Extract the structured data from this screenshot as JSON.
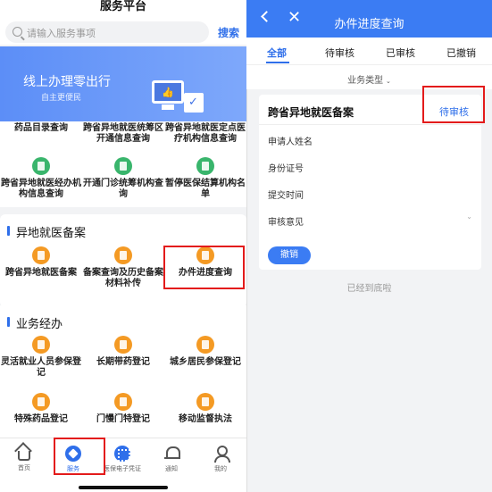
{
  "left": {
    "title": "服务平台",
    "search": {
      "placeholder": "请输入服务事项",
      "button": "搜索"
    },
    "banner": {
      "title": "线上办理零出行",
      "subtitle": "自主更便民"
    },
    "top_row_labels": [
      "药品目录查询",
      "跨省异地就医统筹区开通信息查询",
      "跨省异地就医定点医疗机构信息查询"
    ],
    "query_items": [
      {
        "label": "跨省异地就医经办机构信息查询",
        "icon": "hospital-icon"
      },
      {
        "label": "开通门诊统筹机构查询",
        "icon": "document-icon"
      },
      {
        "label": "暂停医保结算机构名单",
        "icon": "list-icon"
      }
    ],
    "section_filing": {
      "title": "异地就医备案",
      "items": [
        {
          "label": "跨省异地就医备案",
          "icon": "filing-icon"
        },
        {
          "label": "备案查询及历史备案材料补传",
          "icon": "query-icon"
        },
        {
          "label": "办件进度查询",
          "icon": "progress-icon"
        }
      ]
    },
    "section_business": {
      "title": "业务经办",
      "items": [
        {
          "label": "灵活就业人员参保登记",
          "icon": "person-icon"
        },
        {
          "label": "长期带药登记",
          "icon": "medicine-icon"
        },
        {
          "label": "城乡居民参保登记",
          "icon": "edit-icon"
        },
        {
          "label": "特殊药品登记",
          "icon": "pill-icon"
        },
        {
          "label": "门慢门特登记",
          "icon": "clipboard-icon"
        },
        {
          "label": "移动监督执法",
          "icon": "inspect-icon"
        }
      ]
    },
    "tabbar": [
      {
        "label": "首页",
        "icon": "home-icon"
      },
      {
        "label": "服务",
        "icon": "service-icon"
      },
      {
        "label": "医保电子凭证",
        "icon": "qr-code-icon"
      },
      {
        "label": "通知",
        "icon": "bell-icon"
      },
      {
        "label": "我的",
        "icon": "user-icon"
      }
    ],
    "colors": {
      "accent": "#2f6fea",
      "highlight": "#e31b1b",
      "green": "#39b56c",
      "orange": "#f49a24"
    }
  },
  "right": {
    "title": "办件进度查询",
    "tabs": [
      "全部",
      "待审核",
      "已审核",
      "已撤销"
    ],
    "filter_label": "业务类型",
    "card": {
      "title": "跨省异地就医备案",
      "status": "待审核",
      "fields": [
        "申请人姓名",
        "身份证号",
        "提交时间",
        "审核意见"
      ],
      "button": "撤销"
    },
    "bottom_text": "已经到底啦",
    "colors": {
      "header": "#3b7cf3"
    }
  }
}
